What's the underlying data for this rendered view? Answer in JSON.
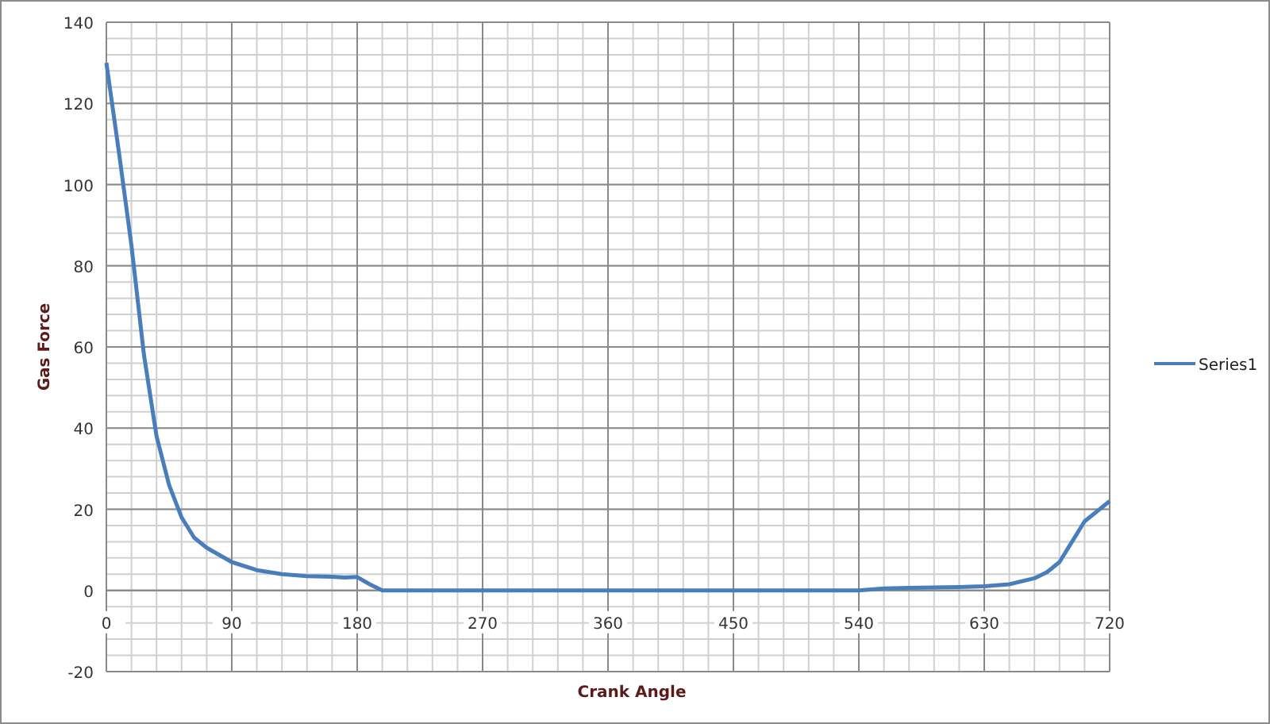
{
  "chart_data": {
    "type": "line",
    "grid": true,
    "xlabel": "Crank Angle",
    "ylabel": "Gas Force",
    "x": [
      0,
      9,
      18,
      27,
      36,
      45,
      54,
      63,
      72,
      90,
      108,
      126,
      144,
      162,
      171,
      180,
      189,
      198,
      216,
      270,
      360,
      450,
      540,
      558,
      576,
      612,
      630,
      648,
      666,
      675,
      684,
      693,
      702,
      720
    ],
    "series": [
      {
        "name": "Series1",
        "color": "#4a7ebb",
        "values": [
          130,
          108,
          85,
          58,
          38,
          26,
          18,
          13,
          10.5,
          7,
          5,
          4,
          3.5,
          3.4,
          3.2,
          3.3,
          1.5,
          0,
          0,
          0,
          0,
          0,
          0,
          0.5,
          0.6,
          0.8,
          1,
          1.5,
          3,
          4.5,
          7,
          12,
          17,
          22
        ]
      }
    ],
    "xlim": [
      0,
      720
    ],
    "ylim": [
      -20,
      140
    ],
    "xticks": [
      0,
      90,
      180,
      270,
      360,
      450,
      540,
      630,
      720
    ],
    "yticks": [
      -20,
      0,
      20,
      40,
      60,
      80,
      100,
      120,
      140
    ]
  }
}
